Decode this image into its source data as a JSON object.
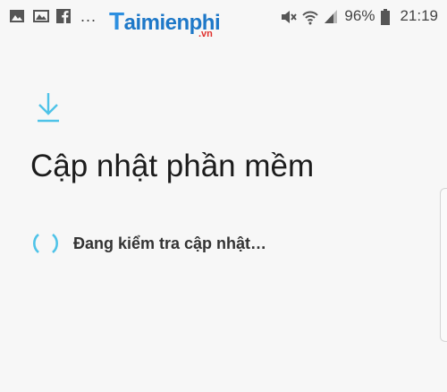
{
  "status_bar": {
    "left_icons": [
      "image-icon",
      "gallery-icon",
      "facebook-icon",
      "more-dots-icon"
    ],
    "more_dots": "...",
    "battery_percent": "96%",
    "time": "21:19",
    "right_icons": [
      "mute-icon",
      "wifi-icon",
      "signal-icon",
      "battery-icon"
    ]
  },
  "watermark": {
    "letter": "T",
    "text": "aimienphi",
    "tld": ".vn"
  },
  "main": {
    "icon": "download-icon",
    "title": "Cập nhật phần mềm",
    "status_text": "Đang kiểm tra cập nhật…",
    "spinner_icon": "spinner-icon"
  },
  "colors": {
    "accent": "#4fc3e8",
    "background": "#f7f7f7",
    "text": "#1c1c1c",
    "watermark_blue": "#1e78c8",
    "watermark_red": "#e0312d"
  }
}
